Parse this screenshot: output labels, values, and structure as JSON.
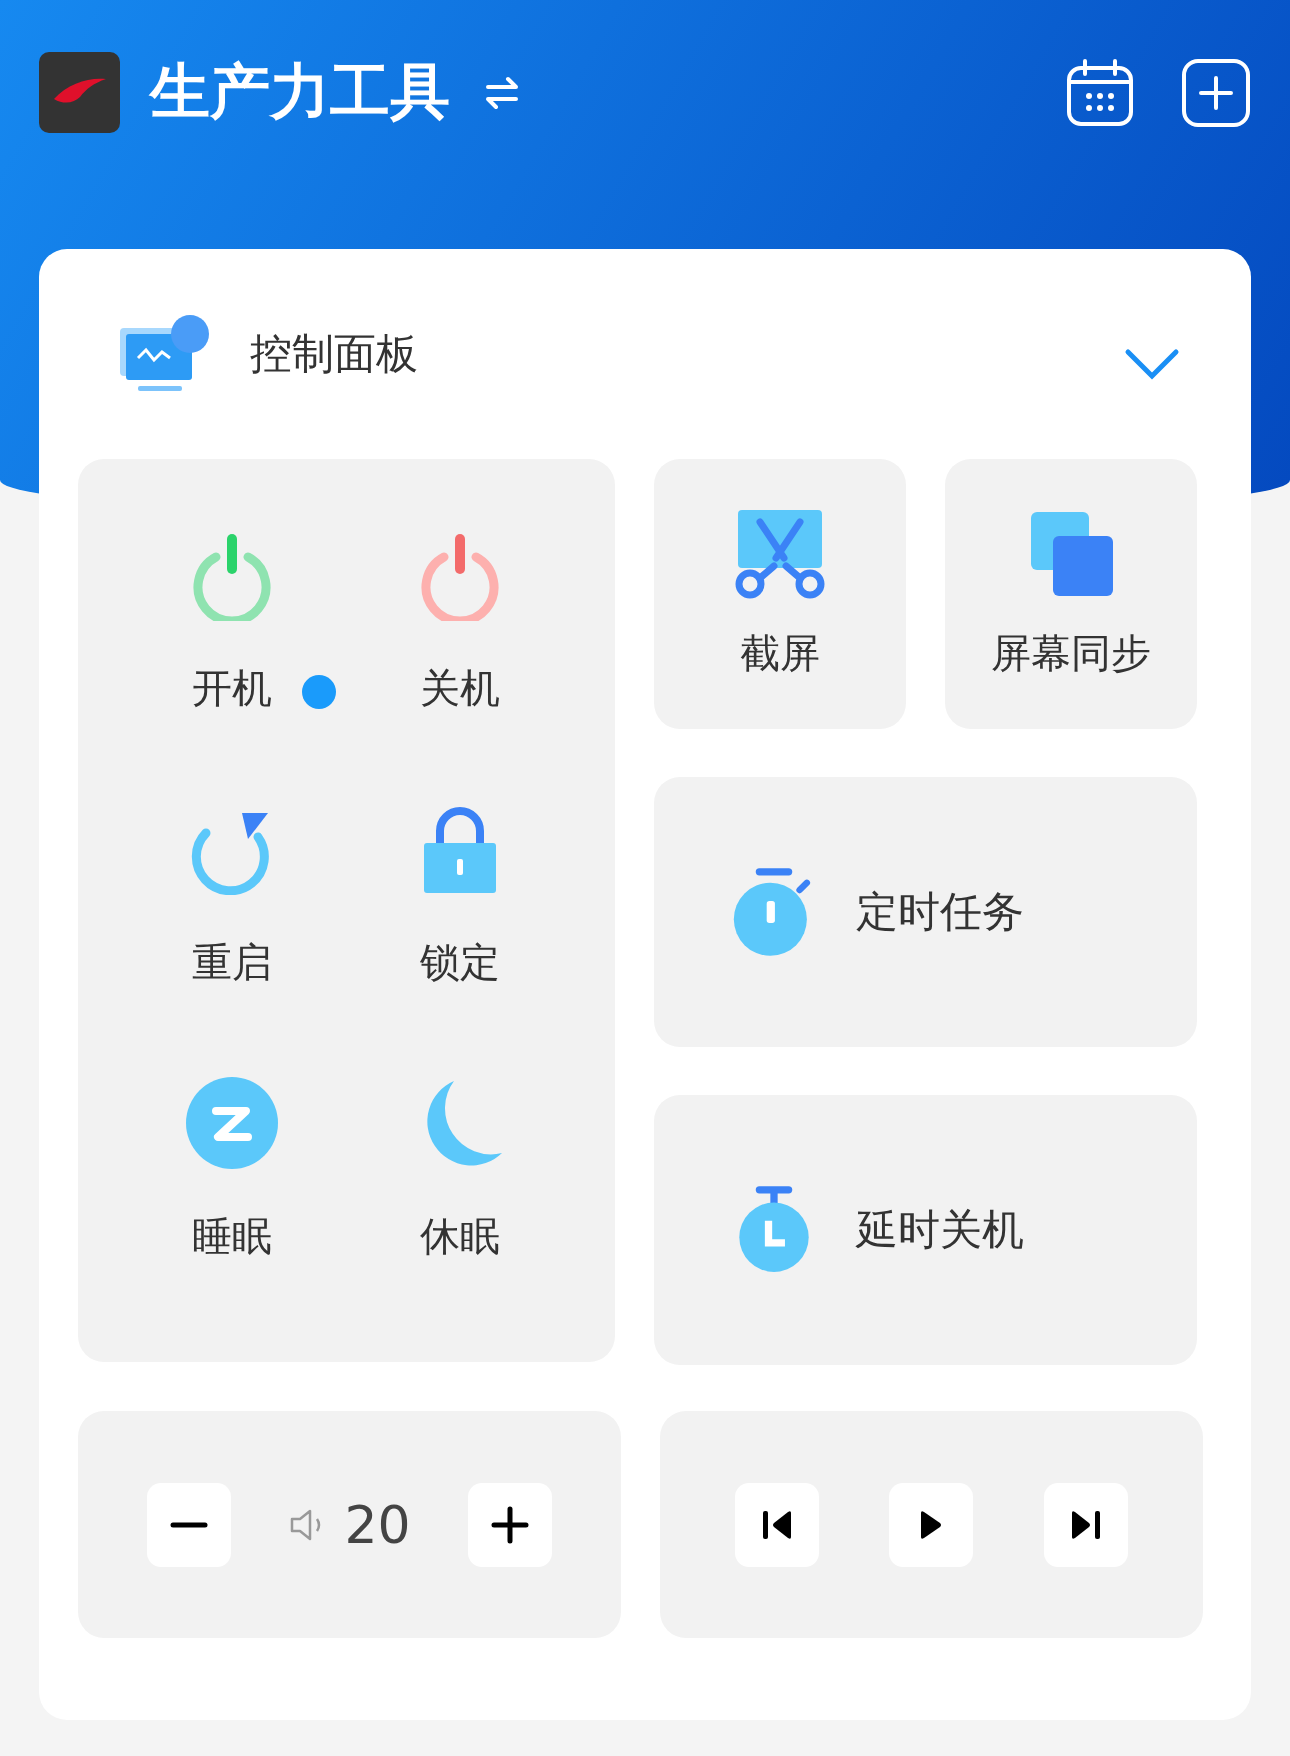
{
  "header": {
    "title": "生产力工具"
  },
  "panel": {
    "title": "控制面板",
    "expanded": false,
    "power_items": [
      {
        "kind": "power_on",
        "label": "开机",
        "indicator": true
      },
      {
        "kind": "power_off",
        "label": "关机",
        "indicator": false
      },
      {
        "kind": "restart",
        "label": "重启",
        "indicator": false
      },
      {
        "kind": "lock",
        "label": "锁定",
        "indicator": false
      },
      {
        "kind": "sleep",
        "label": "睡眠",
        "indicator": false
      },
      {
        "kind": "hibernate",
        "label": "休眠",
        "indicator": false
      }
    ],
    "tools": [
      {
        "kind": "screenshot",
        "label": "截屏"
      },
      {
        "kind": "screen_sync",
        "label": "屏幕同步"
      }
    ],
    "tasks": [
      {
        "kind": "timer",
        "label": "定时任务"
      },
      {
        "kind": "delay",
        "label": "延时关机"
      }
    ],
    "volume": {
      "value": "20"
    }
  }
}
